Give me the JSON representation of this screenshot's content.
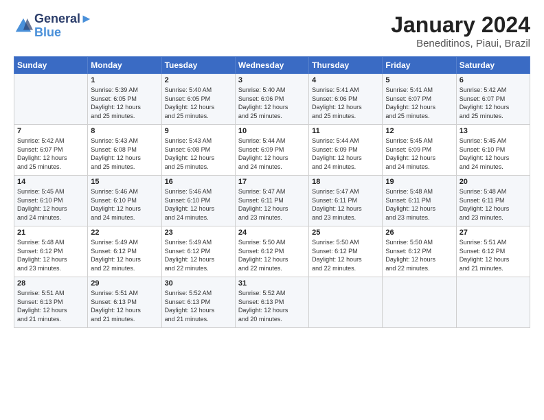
{
  "logo": {
    "line1": "General",
    "line2": "Blue"
  },
  "title": "January 2024",
  "location": "Beneditinos, Piaui, Brazil",
  "weekdays": [
    "Sunday",
    "Monday",
    "Tuesday",
    "Wednesday",
    "Thursday",
    "Friday",
    "Saturday"
  ],
  "weeks": [
    [
      {
        "day": "",
        "info": ""
      },
      {
        "day": "1",
        "info": "Sunrise: 5:39 AM\nSunset: 6:05 PM\nDaylight: 12 hours\nand 25 minutes."
      },
      {
        "day": "2",
        "info": "Sunrise: 5:40 AM\nSunset: 6:05 PM\nDaylight: 12 hours\nand 25 minutes."
      },
      {
        "day": "3",
        "info": "Sunrise: 5:40 AM\nSunset: 6:06 PM\nDaylight: 12 hours\nand 25 minutes."
      },
      {
        "day": "4",
        "info": "Sunrise: 5:41 AM\nSunset: 6:06 PM\nDaylight: 12 hours\nand 25 minutes."
      },
      {
        "day": "5",
        "info": "Sunrise: 5:41 AM\nSunset: 6:07 PM\nDaylight: 12 hours\nand 25 minutes."
      },
      {
        "day": "6",
        "info": "Sunrise: 5:42 AM\nSunset: 6:07 PM\nDaylight: 12 hours\nand 25 minutes."
      }
    ],
    [
      {
        "day": "7",
        "info": "Sunrise: 5:42 AM\nSunset: 6:07 PM\nDaylight: 12 hours\nand 25 minutes."
      },
      {
        "day": "8",
        "info": "Sunrise: 5:43 AM\nSunset: 6:08 PM\nDaylight: 12 hours\nand 25 minutes."
      },
      {
        "day": "9",
        "info": "Sunrise: 5:43 AM\nSunset: 6:08 PM\nDaylight: 12 hours\nand 25 minutes."
      },
      {
        "day": "10",
        "info": "Sunrise: 5:44 AM\nSunset: 6:09 PM\nDaylight: 12 hours\nand 24 minutes."
      },
      {
        "day": "11",
        "info": "Sunrise: 5:44 AM\nSunset: 6:09 PM\nDaylight: 12 hours\nand 24 minutes."
      },
      {
        "day": "12",
        "info": "Sunrise: 5:45 AM\nSunset: 6:09 PM\nDaylight: 12 hours\nand 24 minutes."
      },
      {
        "day": "13",
        "info": "Sunrise: 5:45 AM\nSunset: 6:10 PM\nDaylight: 12 hours\nand 24 minutes."
      }
    ],
    [
      {
        "day": "14",
        "info": "Sunrise: 5:45 AM\nSunset: 6:10 PM\nDaylight: 12 hours\nand 24 minutes."
      },
      {
        "day": "15",
        "info": "Sunrise: 5:46 AM\nSunset: 6:10 PM\nDaylight: 12 hours\nand 24 minutes."
      },
      {
        "day": "16",
        "info": "Sunrise: 5:46 AM\nSunset: 6:10 PM\nDaylight: 12 hours\nand 24 minutes."
      },
      {
        "day": "17",
        "info": "Sunrise: 5:47 AM\nSunset: 6:11 PM\nDaylight: 12 hours\nand 23 minutes."
      },
      {
        "day": "18",
        "info": "Sunrise: 5:47 AM\nSunset: 6:11 PM\nDaylight: 12 hours\nand 23 minutes."
      },
      {
        "day": "19",
        "info": "Sunrise: 5:48 AM\nSunset: 6:11 PM\nDaylight: 12 hours\nand 23 minutes."
      },
      {
        "day": "20",
        "info": "Sunrise: 5:48 AM\nSunset: 6:11 PM\nDaylight: 12 hours\nand 23 minutes."
      }
    ],
    [
      {
        "day": "21",
        "info": "Sunrise: 5:48 AM\nSunset: 6:12 PM\nDaylight: 12 hours\nand 23 minutes."
      },
      {
        "day": "22",
        "info": "Sunrise: 5:49 AM\nSunset: 6:12 PM\nDaylight: 12 hours\nand 22 minutes."
      },
      {
        "day": "23",
        "info": "Sunrise: 5:49 AM\nSunset: 6:12 PM\nDaylight: 12 hours\nand 22 minutes."
      },
      {
        "day": "24",
        "info": "Sunrise: 5:50 AM\nSunset: 6:12 PM\nDaylight: 12 hours\nand 22 minutes."
      },
      {
        "day": "25",
        "info": "Sunrise: 5:50 AM\nSunset: 6:12 PM\nDaylight: 12 hours\nand 22 minutes."
      },
      {
        "day": "26",
        "info": "Sunrise: 5:50 AM\nSunset: 6:12 PM\nDaylight: 12 hours\nand 22 minutes."
      },
      {
        "day": "27",
        "info": "Sunrise: 5:51 AM\nSunset: 6:12 PM\nDaylight: 12 hours\nand 21 minutes."
      }
    ],
    [
      {
        "day": "28",
        "info": "Sunrise: 5:51 AM\nSunset: 6:13 PM\nDaylight: 12 hours\nand 21 minutes."
      },
      {
        "day": "29",
        "info": "Sunrise: 5:51 AM\nSunset: 6:13 PM\nDaylight: 12 hours\nand 21 minutes."
      },
      {
        "day": "30",
        "info": "Sunrise: 5:52 AM\nSunset: 6:13 PM\nDaylight: 12 hours\nand 21 minutes."
      },
      {
        "day": "31",
        "info": "Sunrise: 5:52 AM\nSunset: 6:13 PM\nDaylight: 12 hours\nand 20 minutes."
      },
      {
        "day": "",
        "info": ""
      },
      {
        "day": "",
        "info": ""
      },
      {
        "day": "",
        "info": ""
      }
    ]
  ]
}
